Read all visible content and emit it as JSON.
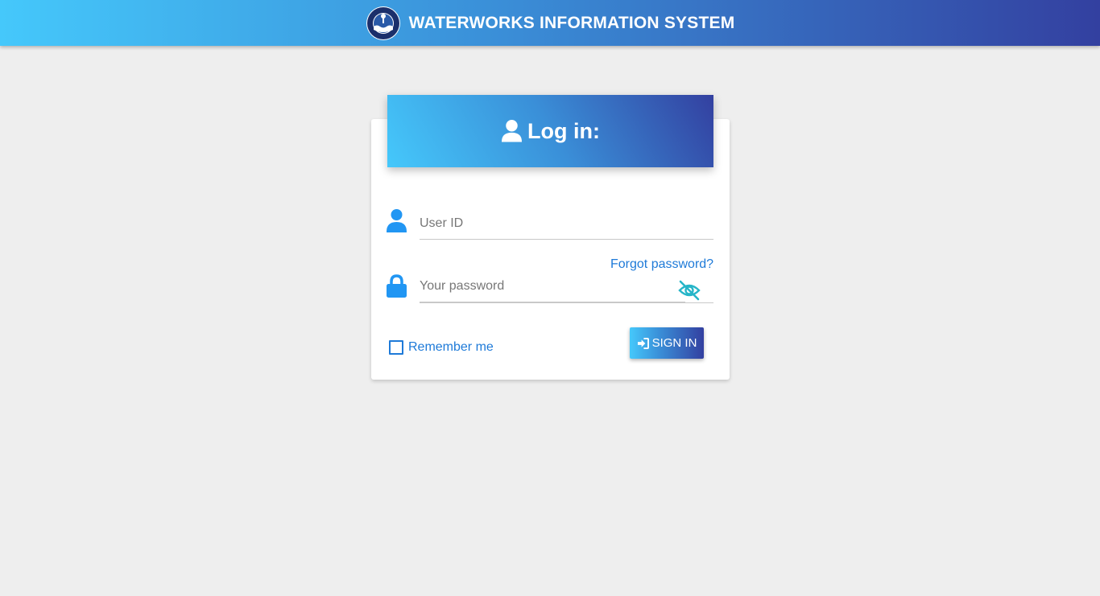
{
  "header": {
    "app_title": "WATERWORKS INFORMATION SYSTEM",
    "logo_icon": "water-district-seal-icon"
  },
  "login_card": {
    "title": "Log in:",
    "title_icon": "user-icon",
    "user_id": {
      "placeholder": "User ID",
      "value": "",
      "icon": "user-icon"
    },
    "password": {
      "placeholder": "Your password",
      "value": "",
      "icon": "lock-icon",
      "toggle_icon": "eye-slash-icon"
    },
    "forgot_password_label": "Forgot password?",
    "remember_me_label": "Remember me",
    "remember_me_checked": false,
    "sign_in_label": "SIGN IN",
    "sign_in_icon": "sign-in-icon"
  },
  "colors": {
    "gradient_start": "#45c8fb",
    "gradient_end": "#3340a0",
    "link": "#1e7ad8",
    "icon_blue": "#2196f3",
    "eye_teal": "#26b5c8",
    "background": "#eeeeee"
  }
}
